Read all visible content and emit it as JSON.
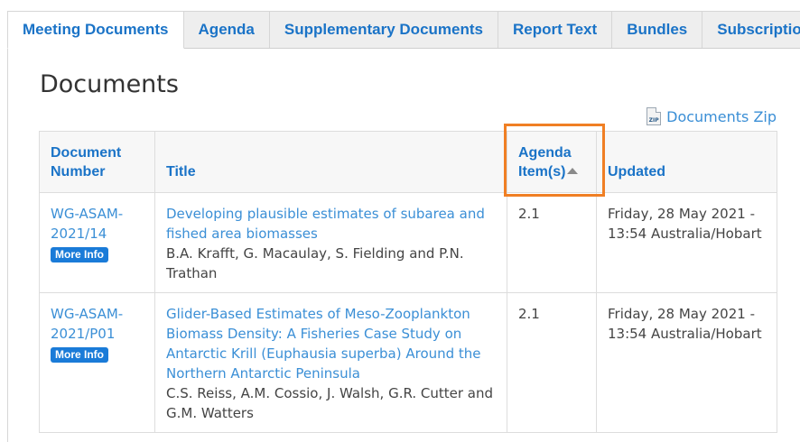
{
  "tabs": [
    {
      "label": "Meeting Documents",
      "active": true
    },
    {
      "label": "Agenda"
    },
    {
      "label": "Supplementary Documents"
    },
    {
      "label": "Report Text"
    },
    {
      "label": "Bundles"
    },
    {
      "label": "Subscriptions"
    }
  ],
  "section_title": "Documents",
  "zip": {
    "label": "Documents Zip",
    "icon": "zip-file-icon",
    "icon_text": "ZIP"
  },
  "table": {
    "headers": {
      "doc_number_line1": "Document",
      "doc_number_line2": "Number",
      "title": "Title",
      "agenda_line1": "Agenda",
      "agenda_line2": "Item(s)",
      "updated": "Updated"
    },
    "sort": {
      "column": "Agenda Item(s)",
      "direction": "ascending",
      "icon": "sort-up-icon"
    },
    "rows": [
      {
        "doc_number_line1": "WG-ASAM-",
        "doc_number_line2": "2021/14",
        "more_info": "More Info",
        "title": "Developing plausible estimates of subarea and fished area biomasses",
        "authors": "B.A. Krafft, G. Macaulay, S. Fielding and P.N. Trathan",
        "agenda": "2.1",
        "updated": "Friday, 28 May 2021 - 13:54 Australia/Hobart"
      },
      {
        "doc_number_line1": "WG-ASAM-",
        "doc_number_line2": "2021/P01",
        "more_info": "More Info",
        "title": "Glider-Based Estimates of Meso-Zooplankton Biomass Density: A Fisheries Case Study on Antarctic Krill (Euphausia superba) Around the Northern Antarctic Peninsula",
        "authors": "C.S. Reiss, A.M. Cossio, J. Walsh, G.R. Cutter and G.M. Watters",
        "agenda": "2.1",
        "updated": "Friday, 28 May 2021 - 13:54 Australia/Hobart"
      }
    ]
  },
  "colors": {
    "accent": "#1a73c7",
    "link": "#3b8fd6",
    "badge": "#1a7bd8",
    "highlight": "#f07f24"
  }
}
